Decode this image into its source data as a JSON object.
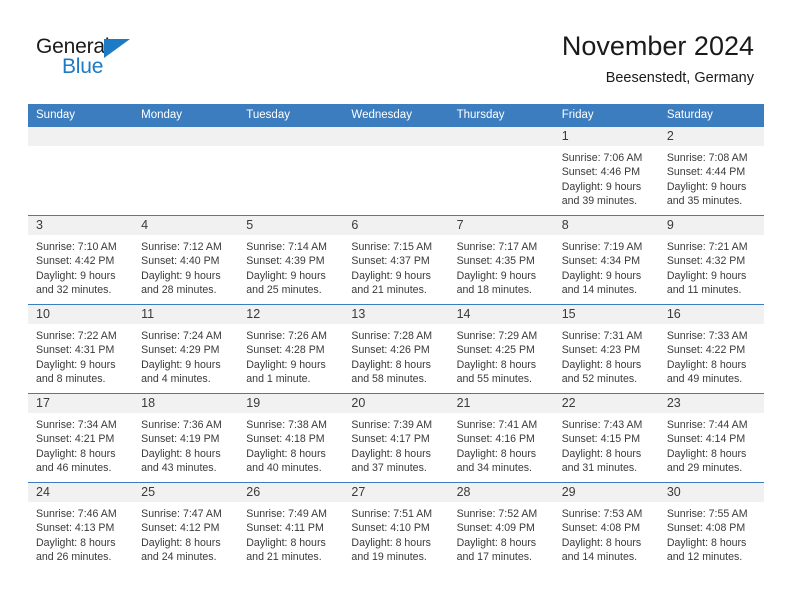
{
  "brand": {
    "name_part1": "General",
    "name_part2": "Blue",
    "accent_color": "#1d7ac4"
  },
  "header": {
    "title": "November 2024",
    "subtitle": "Beesenstedt, Germany"
  },
  "theme": {
    "header_bar_color": "#3c7dbf",
    "day_band_color": "#f1f1f1",
    "text_color": "#3a3a3a"
  },
  "weekdays": [
    "Sunday",
    "Monday",
    "Tuesday",
    "Wednesday",
    "Thursday",
    "Friday",
    "Saturday"
  ],
  "weeks": [
    [
      {
        "day": "",
        "lines": []
      },
      {
        "day": "",
        "lines": []
      },
      {
        "day": "",
        "lines": []
      },
      {
        "day": "",
        "lines": []
      },
      {
        "day": "",
        "lines": []
      },
      {
        "day": "1",
        "lines": [
          "Sunrise: 7:06 AM",
          "Sunset: 4:46 PM",
          "Daylight: 9 hours",
          "and 39 minutes."
        ]
      },
      {
        "day": "2",
        "lines": [
          "Sunrise: 7:08 AM",
          "Sunset: 4:44 PM",
          "Daylight: 9 hours",
          "and 35 minutes."
        ]
      }
    ],
    [
      {
        "day": "3",
        "lines": [
          "Sunrise: 7:10 AM",
          "Sunset: 4:42 PM",
          "Daylight: 9 hours",
          "and 32 minutes."
        ]
      },
      {
        "day": "4",
        "lines": [
          "Sunrise: 7:12 AM",
          "Sunset: 4:40 PM",
          "Daylight: 9 hours",
          "and 28 minutes."
        ]
      },
      {
        "day": "5",
        "lines": [
          "Sunrise: 7:14 AM",
          "Sunset: 4:39 PM",
          "Daylight: 9 hours",
          "and 25 minutes."
        ]
      },
      {
        "day": "6",
        "lines": [
          "Sunrise: 7:15 AM",
          "Sunset: 4:37 PM",
          "Daylight: 9 hours",
          "and 21 minutes."
        ]
      },
      {
        "day": "7",
        "lines": [
          "Sunrise: 7:17 AM",
          "Sunset: 4:35 PM",
          "Daylight: 9 hours",
          "and 18 minutes."
        ]
      },
      {
        "day": "8",
        "lines": [
          "Sunrise: 7:19 AM",
          "Sunset: 4:34 PM",
          "Daylight: 9 hours",
          "and 14 minutes."
        ]
      },
      {
        "day": "9",
        "lines": [
          "Sunrise: 7:21 AM",
          "Sunset: 4:32 PM",
          "Daylight: 9 hours",
          "and 11 minutes."
        ]
      }
    ],
    [
      {
        "day": "10",
        "lines": [
          "Sunrise: 7:22 AM",
          "Sunset: 4:31 PM",
          "Daylight: 9 hours",
          "and 8 minutes."
        ]
      },
      {
        "day": "11",
        "lines": [
          "Sunrise: 7:24 AM",
          "Sunset: 4:29 PM",
          "Daylight: 9 hours",
          "and 4 minutes."
        ]
      },
      {
        "day": "12",
        "lines": [
          "Sunrise: 7:26 AM",
          "Sunset: 4:28 PM",
          "Daylight: 9 hours",
          "and 1 minute."
        ]
      },
      {
        "day": "13",
        "lines": [
          "Sunrise: 7:28 AM",
          "Sunset: 4:26 PM",
          "Daylight: 8 hours",
          "and 58 minutes."
        ]
      },
      {
        "day": "14",
        "lines": [
          "Sunrise: 7:29 AM",
          "Sunset: 4:25 PM",
          "Daylight: 8 hours",
          "and 55 minutes."
        ]
      },
      {
        "day": "15",
        "lines": [
          "Sunrise: 7:31 AM",
          "Sunset: 4:23 PM",
          "Daylight: 8 hours",
          "and 52 minutes."
        ]
      },
      {
        "day": "16",
        "lines": [
          "Sunrise: 7:33 AM",
          "Sunset: 4:22 PM",
          "Daylight: 8 hours",
          "and 49 minutes."
        ]
      }
    ],
    [
      {
        "day": "17",
        "lines": [
          "Sunrise: 7:34 AM",
          "Sunset: 4:21 PM",
          "Daylight: 8 hours",
          "and 46 minutes."
        ]
      },
      {
        "day": "18",
        "lines": [
          "Sunrise: 7:36 AM",
          "Sunset: 4:19 PM",
          "Daylight: 8 hours",
          "and 43 minutes."
        ]
      },
      {
        "day": "19",
        "lines": [
          "Sunrise: 7:38 AM",
          "Sunset: 4:18 PM",
          "Daylight: 8 hours",
          "and 40 minutes."
        ]
      },
      {
        "day": "20",
        "lines": [
          "Sunrise: 7:39 AM",
          "Sunset: 4:17 PM",
          "Daylight: 8 hours",
          "and 37 minutes."
        ]
      },
      {
        "day": "21",
        "lines": [
          "Sunrise: 7:41 AM",
          "Sunset: 4:16 PM",
          "Daylight: 8 hours",
          "and 34 minutes."
        ]
      },
      {
        "day": "22",
        "lines": [
          "Sunrise: 7:43 AM",
          "Sunset: 4:15 PM",
          "Daylight: 8 hours",
          "and 31 minutes."
        ]
      },
      {
        "day": "23",
        "lines": [
          "Sunrise: 7:44 AM",
          "Sunset: 4:14 PM",
          "Daylight: 8 hours",
          "and 29 minutes."
        ]
      }
    ],
    [
      {
        "day": "24",
        "lines": [
          "Sunrise: 7:46 AM",
          "Sunset: 4:13 PM",
          "Daylight: 8 hours",
          "and 26 minutes."
        ]
      },
      {
        "day": "25",
        "lines": [
          "Sunrise: 7:47 AM",
          "Sunset: 4:12 PM",
          "Daylight: 8 hours",
          "and 24 minutes."
        ]
      },
      {
        "day": "26",
        "lines": [
          "Sunrise: 7:49 AM",
          "Sunset: 4:11 PM",
          "Daylight: 8 hours",
          "and 21 minutes."
        ]
      },
      {
        "day": "27",
        "lines": [
          "Sunrise: 7:51 AM",
          "Sunset: 4:10 PM",
          "Daylight: 8 hours",
          "and 19 minutes."
        ]
      },
      {
        "day": "28",
        "lines": [
          "Sunrise: 7:52 AM",
          "Sunset: 4:09 PM",
          "Daylight: 8 hours",
          "and 17 minutes."
        ]
      },
      {
        "day": "29",
        "lines": [
          "Sunrise: 7:53 AM",
          "Sunset: 4:08 PM",
          "Daylight: 8 hours",
          "and 14 minutes."
        ]
      },
      {
        "day": "30",
        "lines": [
          "Sunrise: 7:55 AM",
          "Sunset: 4:08 PM",
          "Daylight: 8 hours",
          "and 12 minutes."
        ]
      }
    ]
  ]
}
